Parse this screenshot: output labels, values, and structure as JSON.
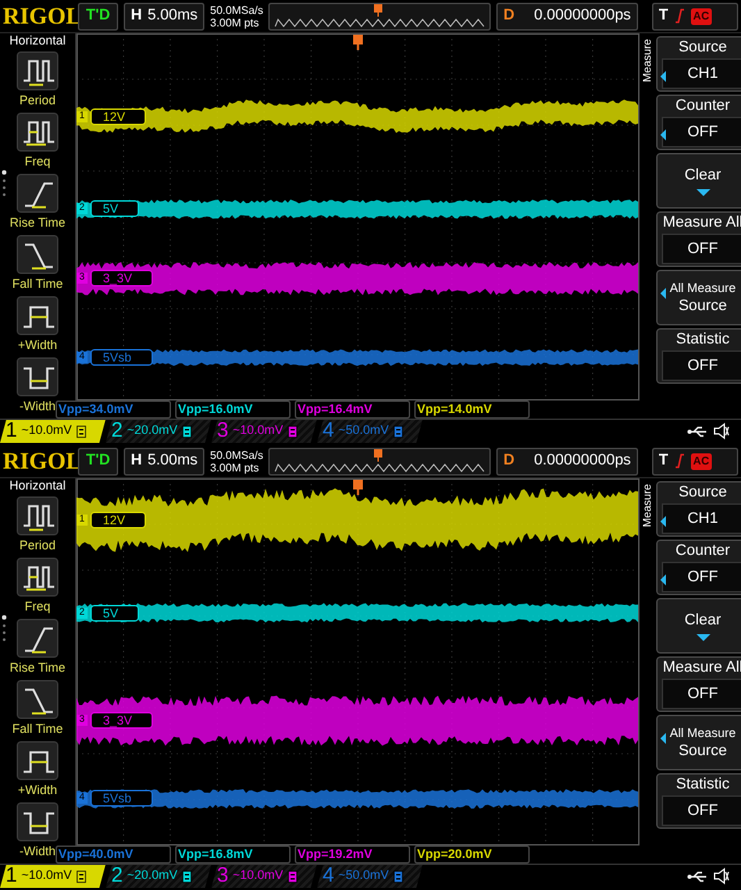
{
  "screens": [
    {
      "logo": "RIGOL",
      "status": "T'D",
      "timebase_label": "H",
      "timebase": "5.00ms",
      "sample_rate": "50.0MSa/s",
      "memory_depth": "3.00M pts",
      "delay_label": "D",
      "delay": "0.00000000ps",
      "trigger_label": "T",
      "trigger_coupling": "AC",
      "left_menu": {
        "title": "Horizontal",
        "items": [
          {
            "label": "Period",
            "kind": "period"
          },
          {
            "label": "Freq",
            "kind": "freq"
          },
          {
            "label": "Rise Time",
            "kind": "rise"
          },
          {
            "label": "Fall Time",
            "kind": "fall"
          },
          {
            "label": "+Width",
            "kind": "pwidth"
          },
          {
            "label": "-Width",
            "kind": "nwidth"
          }
        ]
      },
      "traces": [
        {
          "number": "1",
          "name": "12V",
          "color": "#d8d800"
        },
        {
          "number": "2",
          "name": "5V",
          "color": "#00d8d8"
        },
        {
          "number": "3",
          "name": "3_3V",
          "color": "#e000e0"
        },
        {
          "number": "4",
          "name": "5Vsb",
          "color": "#1a72d8"
        }
      ],
      "measurements": [
        {
          "text": "Vpp=34.0mV",
          "color": "#1a72d8"
        },
        {
          "text": "Vpp=16.0mV",
          "color": "#00d8d8"
        },
        {
          "text": "Vpp=16.4mV",
          "color": "#e000e0"
        },
        {
          "text": "Vpp=14.0mV",
          "color": "#d8d800"
        }
      ],
      "channels": [
        {
          "number": "1",
          "scale": "~10.0mV",
          "color": "#d8d800",
          "selected": true
        },
        {
          "number": "2",
          "scale": "~20.0mV",
          "color": "#00d8d8",
          "selected": false
        },
        {
          "number": "3",
          "scale": "~10.0mV",
          "color": "#e000e0",
          "selected": false
        },
        {
          "number": "4",
          "scale": "~50.0mV",
          "color": "#1a72d8",
          "selected": false
        }
      ],
      "right_menu": {
        "title": "Measure",
        "items": [
          {
            "kind": "select",
            "title": "Source",
            "value": "CH1"
          },
          {
            "kind": "select",
            "title": "Counter",
            "value": "OFF"
          },
          {
            "kind": "action",
            "title": "Clear"
          },
          {
            "kind": "switch",
            "title": "Measure All",
            "value": "OFF"
          },
          {
            "kind": "multi",
            "title": "All Measure",
            "value": "Source"
          },
          {
            "kind": "switch",
            "title": "Statistic",
            "value": "OFF"
          }
        ]
      }
    },
    {
      "logo": "RIGOL",
      "status": "T'D",
      "timebase_label": "H",
      "timebase": "5.00ms",
      "sample_rate": "50.0MSa/s",
      "memory_depth": "3.00M pts",
      "delay_label": "D",
      "delay": "0.00000000ps",
      "trigger_label": "T",
      "trigger_coupling": "AC",
      "left_menu": {
        "title": "Horizontal",
        "items": [
          {
            "label": "Period",
            "kind": "period"
          },
          {
            "label": "Freq",
            "kind": "freq"
          },
          {
            "label": "Rise Time",
            "kind": "rise"
          },
          {
            "label": "Fall Time",
            "kind": "fall"
          },
          {
            "label": "+Width",
            "kind": "pwidth"
          },
          {
            "label": "-Width",
            "kind": "nwidth"
          }
        ]
      },
      "traces": [
        {
          "number": "1",
          "name": "12V",
          "color": "#d8d800"
        },
        {
          "number": "2",
          "name": "5V",
          "color": "#00d8d8"
        },
        {
          "number": "3",
          "name": "3_3V",
          "color": "#e000e0"
        },
        {
          "number": "4",
          "name": "5Vsb",
          "color": "#1a72d8"
        }
      ],
      "measurements": [
        {
          "text": "Vpp=40.0mV",
          "color": "#1a72d8"
        },
        {
          "text": "Vpp=16.8mV",
          "color": "#00d8d8"
        },
        {
          "text": "Vpp=19.2mV",
          "color": "#e000e0"
        },
        {
          "text": "Vpp=20.0mV",
          "color": "#d8d800"
        }
      ],
      "channels": [
        {
          "number": "1",
          "scale": "~10.0mV",
          "color": "#d8d800",
          "selected": true
        },
        {
          "number": "2",
          "scale": "~20.0mV",
          "color": "#00d8d8",
          "selected": false
        },
        {
          "number": "3",
          "scale": "~10.0mV",
          "color": "#e000e0",
          "selected": false
        },
        {
          "number": "4",
          "scale": "~50.0mV",
          "color": "#1a72d8",
          "selected": false
        }
      ],
      "right_menu": {
        "title": "Measure",
        "items": [
          {
            "kind": "select",
            "title": "Source",
            "value": "CH1"
          },
          {
            "kind": "select",
            "title": "Counter",
            "value": "OFF"
          },
          {
            "kind": "action",
            "title": "Clear"
          },
          {
            "kind": "switch",
            "title": "Measure All",
            "value": "OFF"
          },
          {
            "kind": "multi",
            "title": "All Measure",
            "value": "Source"
          },
          {
            "kind": "switch",
            "title": "Statistic",
            "value": "OFF"
          }
        ]
      }
    }
  ]
}
